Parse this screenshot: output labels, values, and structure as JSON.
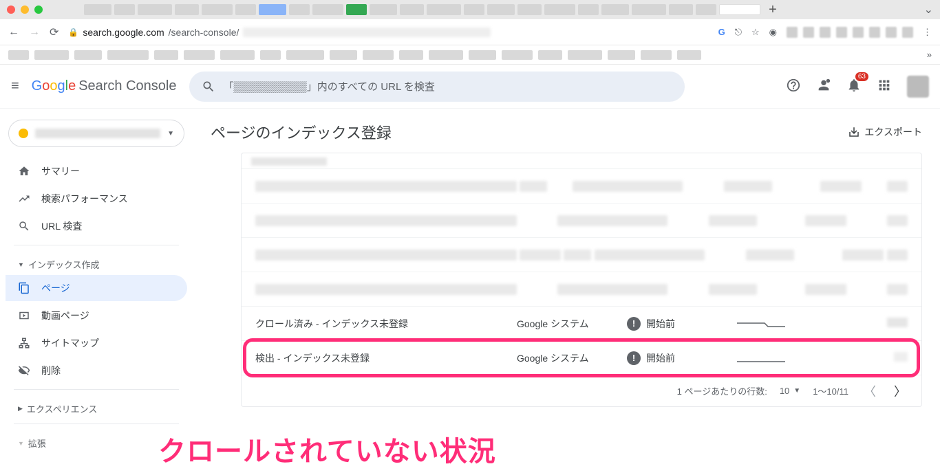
{
  "browser": {
    "url_host": "search.google.com",
    "url_path": "/search-console/"
  },
  "header": {
    "brand_suffix": "Search Console",
    "search_placeholder": "「▒▒▒▒▒▒▒▒▒▒」内のすべての URL を検査",
    "notification_count": "63"
  },
  "sidebar": {
    "items": [
      {
        "label": "サマリー"
      },
      {
        "label": "検索パフォーマンス"
      },
      {
        "label": "URL 検査"
      }
    ],
    "section_indexing": "インデックス作成",
    "indexing_items": [
      {
        "label": "ページ",
        "active": true
      },
      {
        "label": "動画ページ"
      },
      {
        "label": "サイトマップ"
      },
      {
        "label": "削除"
      }
    ],
    "section_experience": "エクスペリエンス",
    "section_enhance": "拡張"
  },
  "page": {
    "title": "ページのインデックス登録",
    "export": "エクスポート"
  },
  "table": {
    "rows": [
      {
        "reason": "クロール済み - インデックス未登録",
        "source": "Google システム",
        "status": "開始前"
      },
      {
        "reason": "検出 - インデックス未登録",
        "source": "Google システム",
        "status": "開始前"
      }
    ],
    "pager": {
      "rows_label": "1 ページあたりの行数:",
      "rows_value": "10",
      "range": "1～10/11"
    }
  },
  "annotation": "クロールされていない状況"
}
